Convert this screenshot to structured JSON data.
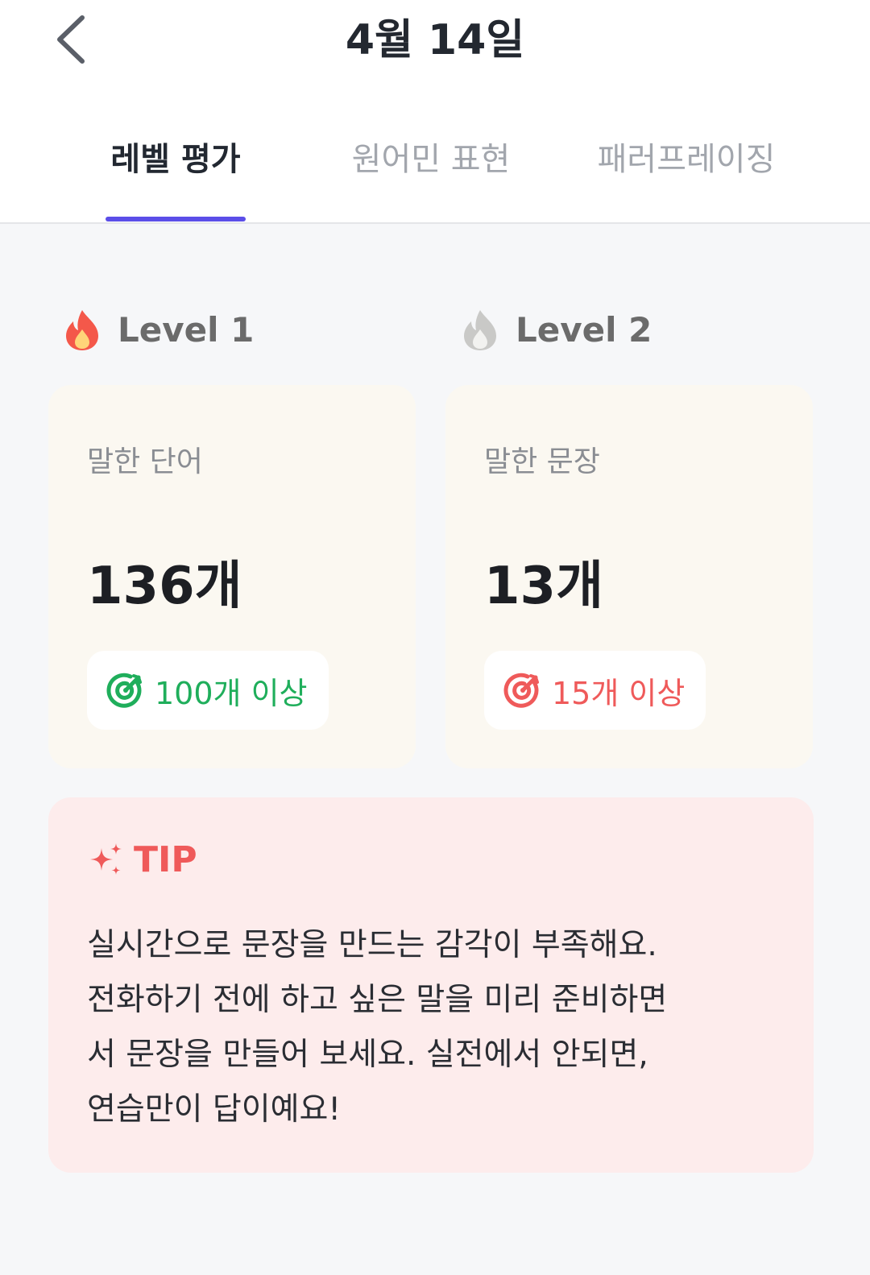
{
  "header": {
    "title": "4월 14일",
    "back_icon": "chevron-left-icon"
  },
  "tabs": [
    {
      "label": "레벨 평가",
      "active": true
    },
    {
      "label": "원어민 표현",
      "active": false
    },
    {
      "label": "패러프레이징",
      "active": false
    }
  ],
  "colors": {
    "accent": "#5b4ee8",
    "success": "#1fae5b",
    "danger": "#ef5a5a",
    "flame_active": "#f4584a",
    "flame_inactive": "#c9c9c7"
  },
  "levels": [
    {
      "label": "Level 1",
      "icon": "flame-icon",
      "active": true,
      "stat_label": "말한 단어",
      "stat_value": "136개",
      "goal_icon": "target-icon",
      "goal_text": "100개 이상",
      "goal_met": true
    },
    {
      "label": "Level 2",
      "icon": "flame-icon",
      "active": false,
      "stat_label": "말한 문장",
      "stat_value": "13개",
      "goal_icon": "target-icon",
      "goal_text": "15개 이상",
      "goal_met": false
    }
  ],
  "tip": {
    "icon": "sparkle-icon",
    "title": "TIP",
    "lines": [
      "실시간으로 문장을 만드는 감각이 부족해요.",
      "전화하기 전에 하고 싶은 말을 미리 준비하면",
      "서 문장을 만들어 보세요. 실전에서 안되면,",
      "연습만이 답이예요!"
    ]
  }
}
